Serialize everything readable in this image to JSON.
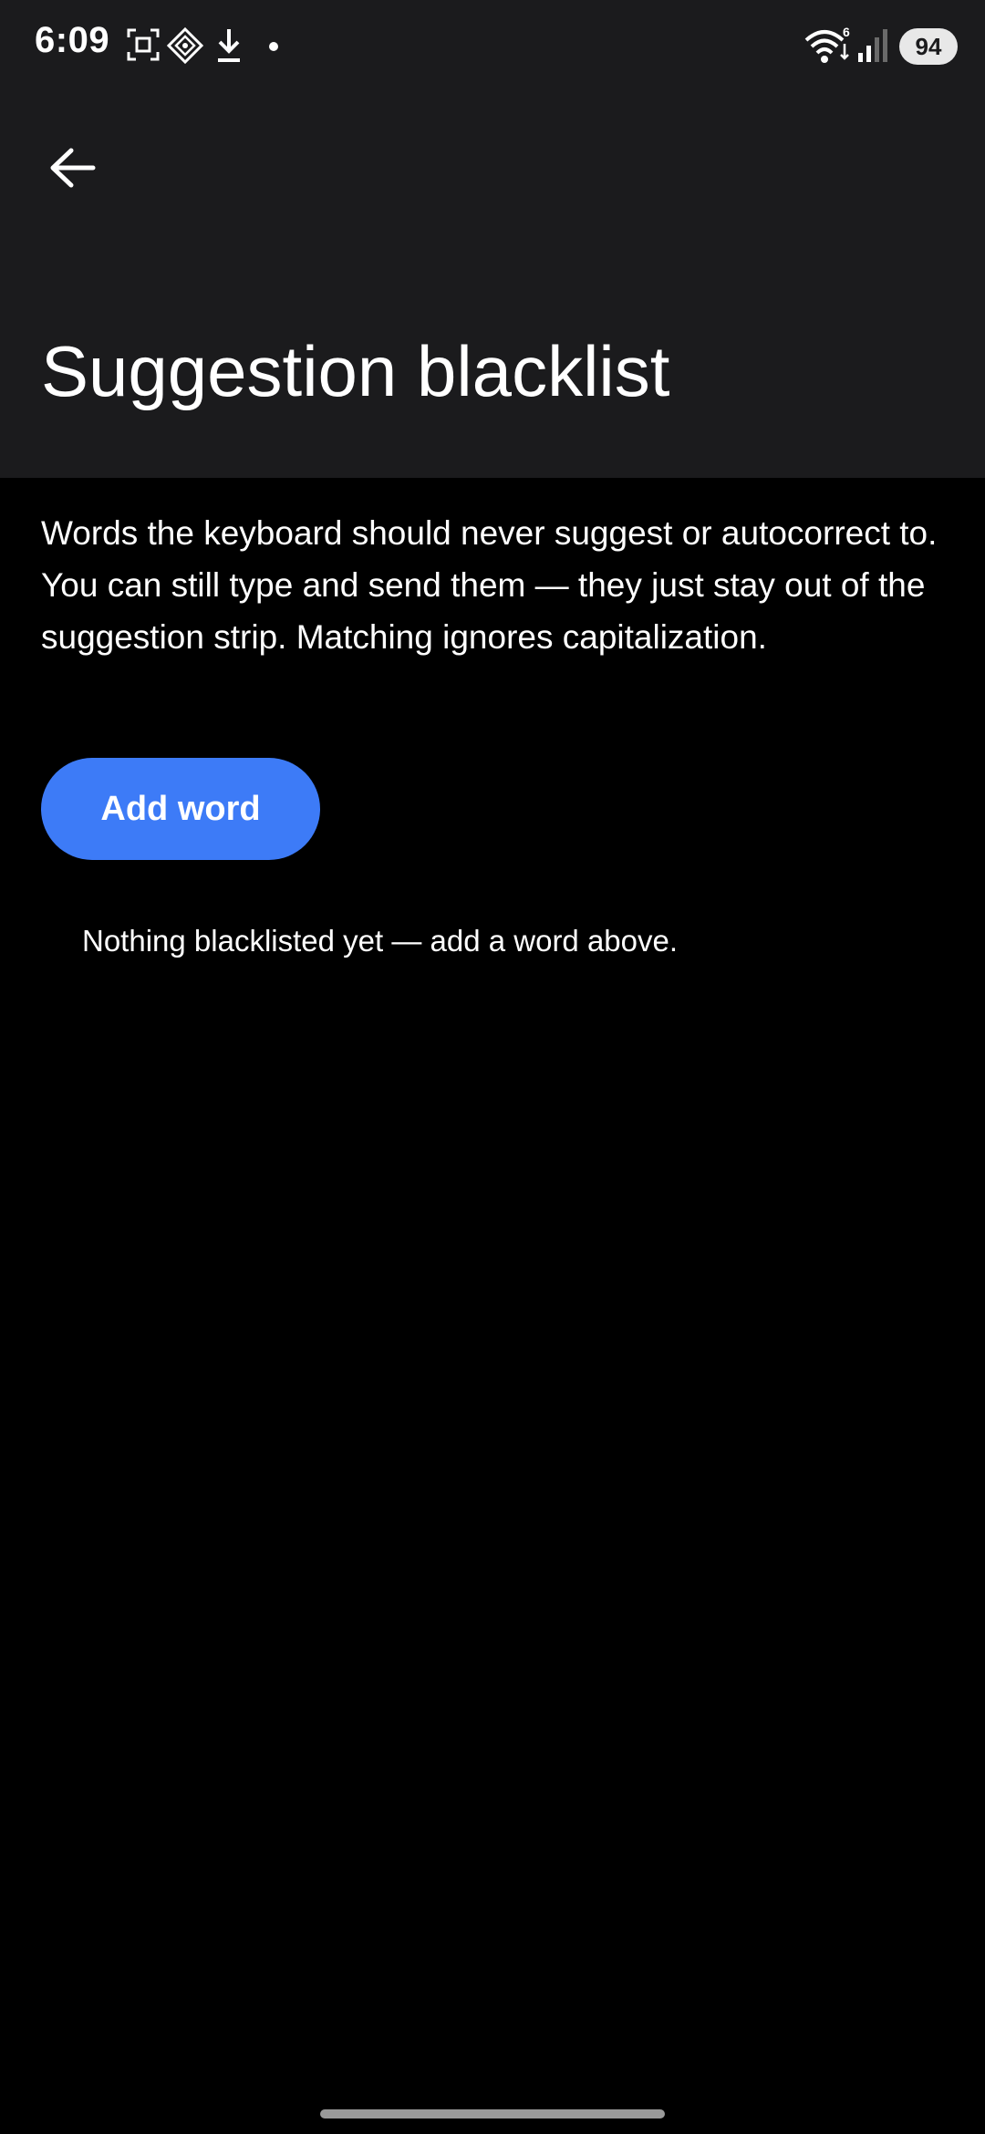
{
  "status_bar": {
    "time": "6:09",
    "battery": "94",
    "icons": [
      "screenshot-icon",
      "app-icon",
      "download-icon",
      "dot-icon",
      "wifi-icon",
      "signal-icon"
    ]
  },
  "header": {
    "back_icon": "back-arrow-icon",
    "title": "Suggestion blacklist"
  },
  "main": {
    "description": "Words the keyboard should never suggest or autocorrect to. You can still type and send them — they just stay out of the suggestion strip. Matching ignores capitalization.",
    "add_button_label": "Add word",
    "empty_text": "Nothing blacklisted yet — add a word above."
  },
  "colors": {
    "header_bg": "#1b1b1d",
    "page_bg": "#000000",
    "accent": "#3d7bf7"
  }
}
